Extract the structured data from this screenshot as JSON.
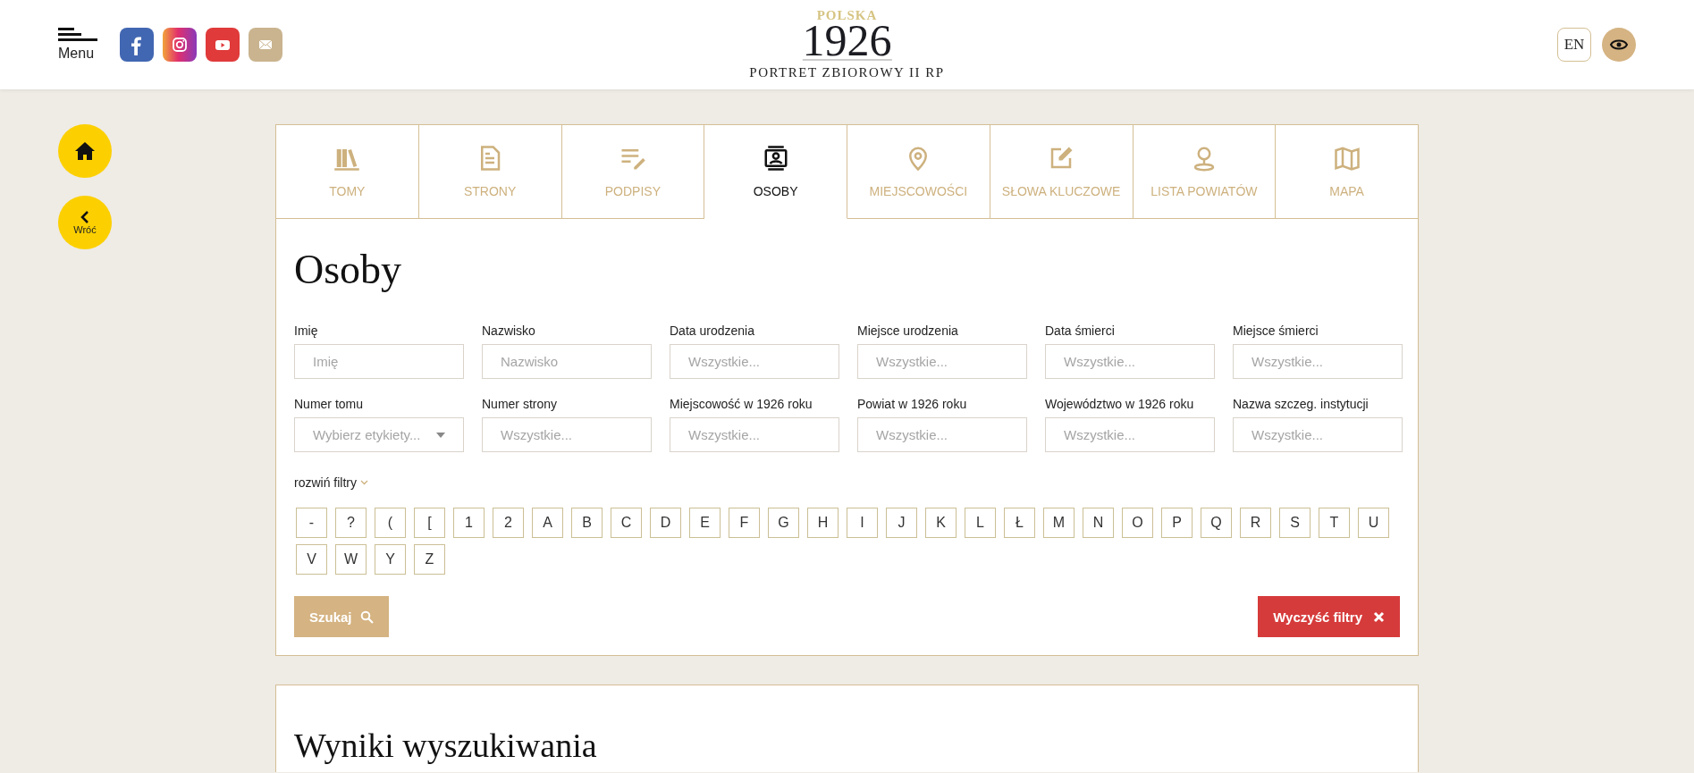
{
  "header": {
    "menu_label": "Menu",
    "social": [
      {
        "kind": "facebook"
      },
      {
        "kind": "instagram"
      },
      {
        "kind": "youtube"
      },
      {
        "kind": "mail"
      }
    ],
    "logo": {
      "top": "POLSKA",
      "year": "1926",
      "subtitle": "PORTRET ZBIOROWY II RP"
    },
    "language": "EN"
  },
  "side_nav": [
    {
      "kind": "home"
    },
    {
      "kind": "back",
      "label": "Wróć"
    }
  ],
  "tabs": [
    {
      "label": "TOMY",
      "kind": "books",
      "selected": false
    },
    {
      "label": "STRONY",
      "kind": "document",
      "selected": false
    },
    {
      "label": "PODPISY",
      "kind": "signature",
      "selected": false
    },
    {
      "label": "OSOBY",
      "kind": "person",
      "selected": true
    },
    {
      "label": "MIEJSCOWOŚCI",
      "kind": "pin",
      "selected": false
    },
    {
      "label": "SŁOWA KLUCZOWE",
      "kind": "edit",
      "selected": false
    },
    {
      "label": "LISTA POWIATÓW",
      "kind": "location",
      "selected": false
    },
    {
      "label": "MAPA",
      "kind": "map",
      "selected": false
    }
  ],
  "page_title": "Osoby",
  "filters": [
    {
      "label": "Imię",
      "placeholder": "Imię",
      "kind": "text"
    },
    {
      "label": "Nazwisko",
      "placeholder": "Nazwisko",
      "kind": "text"
    },
    {
      "label": "Data urodzenia",
      "placeholder": "Wszystkie...",
      "kind": "text"
    },
    {
      "label": "Miejsce urodzenia",
      "placeholder": "Wszystkie...",
      "kind": "text"
    },
    {
      "label": "Data śmierci",
      "placeholder": "Wszystkie...",
      "kind": "text"
    },
    {
      "label": "Miejsce śmierci",
      "placeholder": "Wszystkie...",
      "kind": "text"
    },
    {
      "label": "Numer tomu",
      "placeholder": "Wybierz etykiety...",
      "kind": "select"
    },
    {
      "label": "Numer strony",
      "placeholder": "Wszystkie...",
      "kind": "text"
    },
    {
      "label": "Miejscowość w 1926 roku",
      "placeholder": "Wszystkie...",
      "kind": "text"
    },
    {
      "label": "Powiat w 1926 roku",
      "placeholder": "Wszystkie...",
      "kind": "text"
    },
    {
      "label": "Województwo w 1926 roku",
      "placeholder": "Wszystkie...",
      "kind": "text"
    },
    {
      "label": "Nazwa szczeg. instytucji",
      "placeholder": "Wszystkie...",
      "kind": "text"
    }
  ],
  "expand_filters": "rozwiń filtry",
  "letters": [
    "-",
    "?",
    "(",
    "[",
    "1",
    "2",
    "A",
    "B",
    "C",
    "D",
    "E",
    "F",
    "G",
    "H",
    "I",
    "J",
    "K",
    "L",
    "Ł",
    "M",
    "N",
    "O",
    "P",
    "Q",
    "R",
    "S",
    "T",
    "U",
    "V",
    "W",
    "Y",
    "Z"
  ],
  "search_button": "Szukaj",
  "clear_button": "Wyczyść filtry",
  "results_title": "Wyniki wyszukiwania"
}
